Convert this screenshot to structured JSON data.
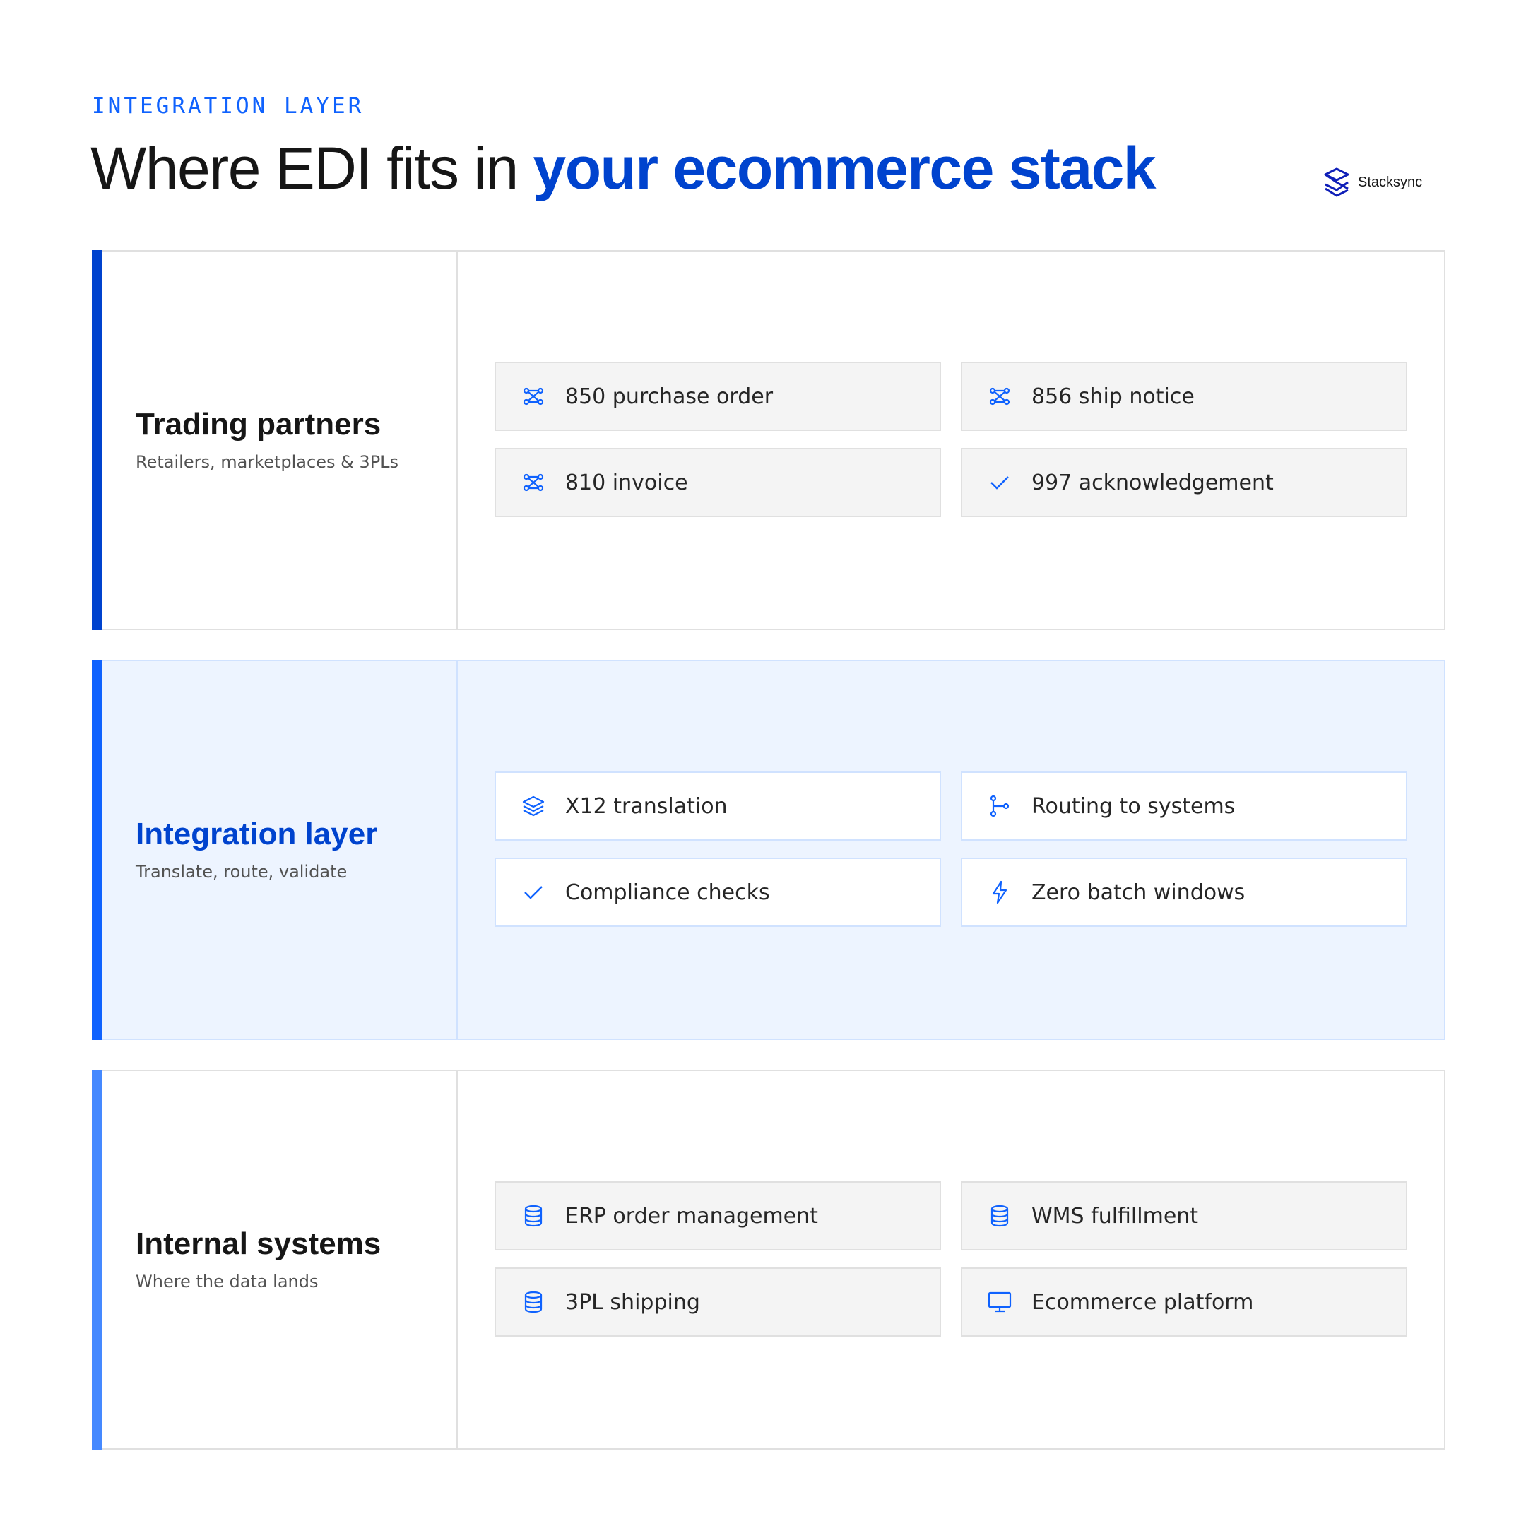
{
  "header": {
    "eyebrow": "INTEGRATION LAYER",
    "title_plain": "Where EDI fits in ",
    "title_accent": "your ecommerce stack",
    "brand": "Stacksync"
  },
  "colors": {
    "accent": "#0f62fe",
    "accent_dark": "#0043ce",
    "bar_trading": "#0043ce",
    "bar_integration": "#0f62fe",
    "bar_internal": "#4589ff"
  },
  "layers": [
    {
      "title": "Trading partners",
      "subtitle": "Retailers, marketplaces & 3PLs",
      "items": [
        {
          "icon": "flow-icon",
          "label": "850 purchase order"
        },
        {
          "icon": "flow-icon",
          "label": "856 ship notice"
        },
        {
          "icon": "flow-icon",
          "label": "810 invoice"
        },
        {
          "icon": "checkmark-icon",
          "label": "997 acknowledgement"
        }
      ]
    },
    {
      "title": "Integration layer",
      "subtitle": "Translate, route, validate",
      "items": [
        {
          "icon": "layers-icon",
          "label": "X12 translation"
        },
        {
          "icon": "branch-icon",
          "label": "Routing to systems"
        },
        {
          "icon": "checkmark-icon",
          "label": "Compliance checks"
        },
        {
          "icon": "lightning-icon",
          "label": "Zero batch windows"
        }
      ]
    },
    {
      "title": "Internal systems",
      "subtitle": "Where the data lands",
      "items": [
        {
          "icon": "database-icon",
          "label": "ERP order management"
        },
        {
          "icon": "database-icon",
          "label": "WMS fulfillment"
        },
        {
          "icon": "database-icon",
          "label": "3PL shipping"
        },
        {
          "icon": "monitor-icon",
          "label": "Ecommerce platform"
        }
      ]
    }
  ]
}
